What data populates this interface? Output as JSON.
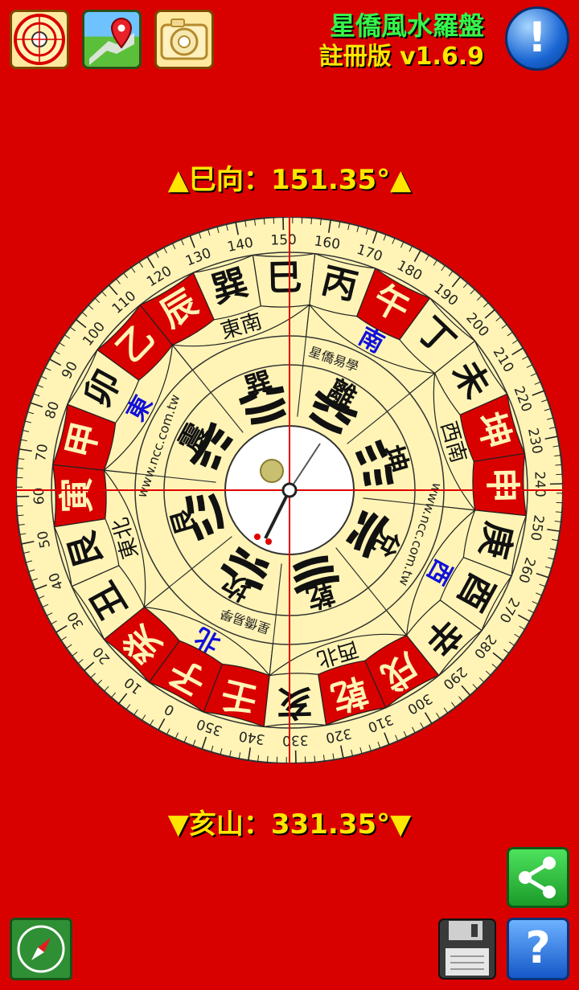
{
  "app": {
    "title_line1": "星僑風水羅盤",
    "title_line2": "註冊版 v1.6.9"
  },
  "toolbar": {
    "info_label": "!",
    "help_label": "?"
  },
  "readout": {
    "top": "▲巳向：151.35°▲",
    "bottom": "▼亥山：331.35°▼"
  },
  "compass": {
    "heading_deg": 151.35,
    "outer_mountains": [
      "壬",
      "子",
      "癸",
      "丑",
      "艮",
      "寅",
      "甲",
      "卯",
      "乙",
      "辰",
      "巽",
      "巳",
      "丙",
      "午",
      "丁",
      "未",
      "坤",
      "申",
      "庚",
      "酉",
      "辛",
      "戌",
      "乾",
      "亥"
    ],
    "red_mountains": [
      "子",
      "癸",
      "寅",
      "甲",
      "乙",
      "辰",
      "午",
      "坤",
      "申",
      "乾",
      "戌",
      "壬"
    ],
    "directions": [
      {
        "label": "東",
        "deg": 90,
        "color": "#1010d8"
      },
      {
        "label": "南",
        "deg": 180,
        "color": "#1010d8"
      },
      {
        "label": "西",
        "deg": 270,
        "color": "#1010d8"
      },
      {
        "label": "北",
        "deg": 0,
        "color": "#1010d8"
      }
    ],
    "sector_labels": [
      {
        "label": "東北",
        "deg": 45
      },
      {
        "label": "東南",
        "deg": 135
      },
      {
        "label": "西南",
        "deg": 225
      },
      {
        "label": "西北",
        "deg": 315
      }
    ],
    "trigrams": [
      {
        "name": "坎",
        "deg": 0
      },
      {
        "name": "艮",
        "deg": 45
      },
      {
        "name": "震",
        "deg": 90
      },
      {
        "name": "巽",
        "deg": 135
      },
      {
        "name": "離",
        "deg": 180
      },
      {
        "name": "坤",
        "deg": 225
      },
      {
        "name": "兌",
        "deg": 270
      },
      {
        "name": "乾",
        "deg": 315
      }
    ],
    "ring_texts": [
      {
        "text": "www.ncc.com.tw",
        "deg": 80
      },
      {
        "text": "星僑易學",
        "deg": 170
      },
      {
        "text": "www.ncc.com.tw",
        "deg": 260
      },
      {
        "text": "星僑易學",
        "deg": 350
      }
    ],
    "colors": {
      "ring_bg": "#fff4b5",
      "red_cell": "#d90000",
      "line": "#222222"
    }
  }
}
